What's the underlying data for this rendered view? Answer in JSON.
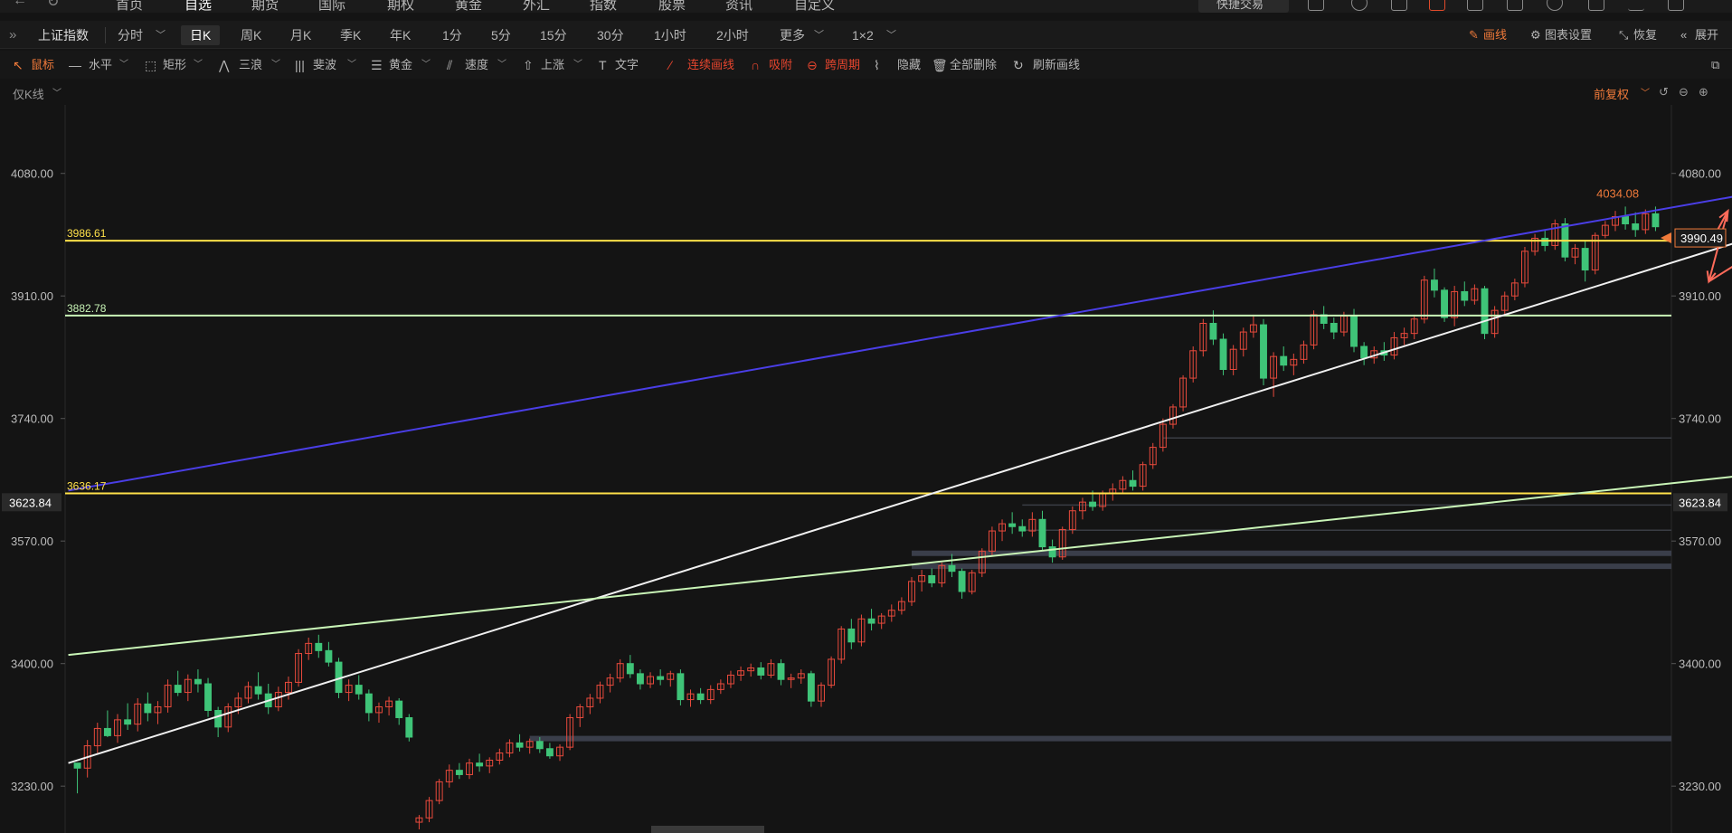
{
  "topnav": {
    "items": [
      "首页",
      "自选",
      "期货",
      "国际",
      "期权",
      "黄金",
      "外汇",
      "指数",
      "股票",
      "资讯",
      "自定义"
    ],
    "active_index": 1,
    "quick_trade": "快捷交易",
    "icons": [
      "back-icon",
      "refresh-icon",
      "layers-icon",
      "window-icon",
      "alert-icon",
      "chart-icon",
      "mail-icon",
      "user-icon",
      "minimize-icon",
      "close-icon"
    ]
  },
  "toolbar": {
    "symbol": "上证指数",
    "periods": [
      "分时",
      "日K",
      "周K",
      "月K",
      "季K",
      "年K",
      "1分",
      "5分",
      "15分",
      "30分",
      "1小时",
      "2小时",
      "更多",
      "1×2"
    ],
    "selected_period": "日K",
    "right": {
      "draw": "画线",
      "settings": "图表设置",
      "restore": "恢复",
      "expand": "展开"
    }
  },
  "drawbar": {
    "mouse": "鼠标",
    "hline": "水平",
    "rect": "矩形",
    "wave3": "三浪",
    "fib": "斐波",
    "gold": "黄金",
    "speed": "速度",
    "rise": "上涨",
    "text": "文字",
    "continuous": "连续画线",
    "snap": "吸附",
    "cross_period": "跨周期",
    "hide": "隐藏",
    "delete_all": "全部删除",
    "refresh_lines": "刷新画线"
  },
  "chart_header": {
    "kline_mode": "仅K线",
    "adjust": "前复权"
  },
  "colors": {
    "up": "#e84a3c",
    "down": "#3fc478",
    "yellow": "#ffe14a",
    "green_line": "#c9f5b7",
    "blue_line": "#4a3ee6",
    "white_line": "#f0f0f0",
    "arrow": "#ff6b5a",
    "bg": "#141414"
  },
  "chart_data": {
    "type": "candlestick",
    "axis_left_ticks": [
      "4080.00",
      "3910.00",
      "3740.00",
      "3570.00",
      "3400.00",
      "3230.00"
    ],
    "axis_right_ticks": [
      "4080.00",
      "3910.00",
      "3740.00",
      "3570.00",
      "3400.00",
      "3230.00"
    ],
    "ylim": [
      3165,
      4175
    ],
    "hlines": [
      {
        "label": "3986.61",
        "value": 3986.61,
        "color": "yellow"
      },
      {
        "label": "3882.78",
        "value": 3882.78,
        "color": "green"
      },
      {
        "label": "3636.17",
        "value": 3636.17,
        "color": "yellow"
      }
    ],
    "left_price_box": "3623.84",
    "right_price_box": "3623.84",
    "current_price": "3990.49",
    "high_label": "4034.08",
    "candles": [
      [
        3262,
        3262,
        3220,
        3255
      ],
      [
        3255,
        3294,
        3242,
        3286
      ],
      [
        3286,
        3318,
        3276,
        3310
      ],
      [
        3310,
        3335,
        3298,
        3300
      ],
      [
        3300,
        3330,
        3290,
        3322
      ],
      [
        3322,
        3345,
        3308,
        3316
      ],
      [
        3316,
        3352,
        3306,
        3344
      ],
      [
        3344,
        3360,
        3320,
        3332
      ],
      [
        3332,
        3348,
        3316,
        3340
      ],
      [
        3340,
        3378,
        3332,
        3370
      ],
      [
        3370,
        3390,
        3355,
        3360
      ],
      [
        3360,
        3385,
        3348,
        3378
      ],
      [
        3378,
        3392,
        3360,
        3372
      ],
      [
        3372,
        3380,
        3326,
        3335
      ],
      [
        3335,
        3340,
        3298,
        3312
      ],
      [
        3312,
        3345,
        3305,
        3340
      ],
      [
        3340,
        3360,
        3330,
        3352
      ],
      [
        3352,
        3375,
        3345,
        3368
      ],
      [
        3368,
        3388,
        3350,
        3358
      ],
      [
        3358,
        3372,
        3330,
        3340
      ],
      [
        3340,
        3368,
        3334,
        3360
      ],
      [
        3360,
        3382,
        3350,
        3374
      ],
      [
        3374,
        3420,
        3368,
        3414
      ],
      [
        3414,
        3436,
        3405,
        3428
      ],
      [
        3428,
        3440,
        3408,
        3418
      ],
      [
        3418,
        3430,
        3396,
        3402
      ],
      [
        3402,
        3408,
        3352,
        3360
      ],
      [
        3360,
        3378,
        3348,
        3370
      ],
      [
        3370,
        3384,
        3350,
        3358
      ],
      [
        3358,
        3364,
        3320,
        3332
      ],
      [
        3332,
        3346,
        3318,
        3340
      ],
      [
        3340,
        3354,
        3328,
        3348
      ],
      [
        3348,
        3352,
        3315,
        3325
      ],
      [
        3325,
        3330,
        3292,
        3298
      ],
      [
        3180,
        3190,
        3170,
        3186
      ],
      [
        3186,
        3215,
        3180,
        3210
      ],
      [
        3210,
        3240,
        3205,
        3236
      ],
      [
        3236,
        3260,
        3228,
        3252
      ],
      [
        3252,
        3262,
        3240,
        3246
      ],
      [
        3246,
        3268,
        3240,
        3262
      ],
      [
        3262,
        3275,
        3250,
        3258
      ],
      [
        3258,
        3270,
        3248,
        3266
      ],
      [
        3266,
        3282,
        3260,
        3276
      ],
      [
        3276,
        3295,
        3270,
        3290
      ],
      [
        3290,
        3302,
        3278,
        3284
      ],
      [
        3284,
        3296,
        3275,
        3292
      ],
      [
        3292,
        3298,
        3276,
        3282
      ],
      [
        3282,
        3290,
        3268,
        3272
      ],
      [
        3272,
        3288,
        3265,
        3284
      ],
      [
        3284,
        3330,
        3280,
        3325
      ],
      [
        3325,
        3344,
        3312,
        3340
      ],
      [
        3340,
        3358,
        3330,
        3352
      ],
      [
        3352,
        3375,
        3345,
        3370
      ],
      [
        3370,
        3386,
        3360,
        3380
      ],
      [
        3380,
        3406,
        3374,
        3400
      ],
      [
        3400,
        3412,
        3380,
        3386
      ],
      [
        3386,
        3392,
        3364,
        3372
      ],
      [
        3372,
        3388,
        3366,
        3382
      ],
      [
        3382,
        3392,
        3370,
        3378
      ],
      [
        3378,
        3390,
        3368,
        3386
      ],
      [
        3386,
        3392,
        3342,
        3350
      ],
      [
        3350,
        3364,
        3340,
        3358
      ],
      [
        3358,
        3366,
        3344,
        3350
      ],
      [
        3350,
        3370,
        3344,
        3364
      ],
      [
        3364,
        3378,
        3358,
        3372
      ],
      [
        3372,
        3390,
        3366,
        3384
      ],
      [
        3384,
        3396,
        3376,
        3390
      ],
      [
        3390,
        3400,
        3382,
        3394
      ],
      [
        3394,
        3402,
        3378,
        3384
      ],
      [
        3384,
        3406,
        3380,
        3400
      ],
      [
        3400,
        3406,
        3370,
        3378
      ],
      [
        3378,
        3386,
        3366,
        3380
      ],
      [
        3380,
        3392,
        3372,
        3386
      ],
      [
        3386,
        3390,
        3340,
        3348
      ],
      [
        3348,
        3374,
        3340,
        3370
      ],
      [
        3370,
        3410,
        3366,
        3406
      ],
      [
        3406,
        3452,
        3400,
        3448
      ],
      [
        3448,
        3462,
        3420,
        3430
      ],
      [
        3430,
        3468,
        3424,
        3462
      ],
      [
        3462,
        3476,
        3446,
        3456
      ],
      [
        3456,
        3470,
        3448,
        3466
      ],
      [
        3466,
        3482,
        3458,
        3474
      ],
      [
        3474,
        3492,
        3468,
        3486
      ],
      [
        3486,
        3520,
        3480,
        3514
      ],
      [
        3514,
        3530,
        3500,
        3522
      ],
      [
        3522,
        3532,
        3506,
        3512
      ],
      [
        3512,
        3540,
        3506,
        3536
      ],
      [
        3536,
        3552,
        3520,
        3528
      ],
      [
        3528,
        3532,
        3490,
        3500
      ],
      [
        3500,
        3530,
        3496,
        3526
      ],
      [
        3526,
        3560,
        3520,
        3556
      ],
      [
        3556,
        3590,
        3550,
        3584
      ],
      [
        3584,
        3600,
        3570,
        3594
      ],
      [
        3594,
        3610,
        3580,
        3590
      ],
      [
        3590,
        3600,
        3576,
        3584
      ],
      [
        3584,
        3610,
        3576,
        3600
      ],
      [
        3600,
        3612,
        3556,
        3562
      ],
      [
        3562,
        3572,
        3540,
        3548
      ],
      [
        3548,
        3590,
        3544,
        3586
      ],
      [
        3586,
        3618,
        3580,
        3612
      ],
      [
        3612,
        3630,
        3600,
        3624
      ],
      [
        3624,
        3640,
        3612,
        3618
      ],
      [
        3618,
        3640,
        3612,
        3636
      ],
      [
        3636,
        3650,
        3626,
        3642
      ],
      [
        3642,
        3660,
        3636,
        3654
      ],
      [
        3654,
        3668,
        3640,
        3646
      ],
      [
        3646,
        3680,
        3640,
        3676
      ],
      [
        3676,
        3706,
        3670,
        3700
      ],
      [
        3700,
        3740,
        3694,
        3732
      ],
      [
        3732,
        3760,
        3726,
        3756
      ],
      [
        3756,
        3800,
        3750,
        3796
      ],
      [
        3796,
        3840,
        3790,
        3834
      ],
      [
        3834,
        3878,
        3826,
        3872
      ],
      [
        3872,
        3890,
        3842,
        3850
      ],
      [
        3850,
        3858,
        3800,
        3808
      ],
      [
        3808,
        3842,
        3800,
        3836
      ],
      [
        3836,
        3866,
        3826,
        3860
      ],
      [
        3860,
        3884,
        3852,
        3870
      ],
      [
        3870,
        3878,
        3786,
        3796
      ],
      [
        3796,
        3832,
        3770,
        3826
      ],
      [
        3826,
        3840,
        3806,
        3814
      ],
      [
        3814,
        3830,
        3800,
        3822
      ],
      [
        3822,
        3848,
        3816,
        3842
      ],
      [
        3842,
        3890,
        3836,
        3884
      ],
      [
        3884,
        3896,
        3864,
        3872
      ],
      [
        3872,
        3880,
        3850,
        3860
      ],
      [
        3860,
        3888,
        3854,
        3882
      ],
      [
        3882,
        3892,
        3832,
        3840
      ],
      [
        3840,
        3846,
        3814,
        3824
      ],
      [
        3824,
        3840,
        3816,
        3834
      ],
      [
        3834,
        3846,
        3820,
        3828
      ],
      [
        3828,
        3860,
        3822,
        3852
      ],
      [
        3852,
        3866,
        3842,
        3858
      ],
      [
        3858,
        3884,
        3850,
        3878
      ],
      [
        3878,
        3938,
        3872,
        3932
      ],
      [
        3932,
        3948,
        3908,
        3918
      ],
      [
        3918,
        3922,
        3874,
        3880
      ],
      [
        3880,
        3924,
        3868,
        3916
      ],
      [
        3916,
        3930,
        3896,
        3904
      ],
      [
        3904,
        3926,
        3898,
        3920
      ],
      [
        3920,
        3924,
        3850,
        3858
      ],
      [
        3858,
        3896,
        3852,
        3890
      ],
      [
        3890,
        3916,
        3884,
        3910
      ],
      [
        3910,
        3934,
        3904,
        3928
      ],
      [
        3928,
        3978,
        3922,
        3972
      ],
      [
        3972,
        3996,
        3966,
        3990
      ],
      [
        3990,
        4002,
        3972,
        3980
      ],
      [
        3980,
        4016,
        3974,
        4010
      ],
      [
        4010,
        4018,
        3958,
        3964
      ],
      [
        3964,
        3982,
        3954,
        3976
      ],
      [
        3976,
        3986,
        3930,
        3946
      ],
      [
        3946,
        3998,
        3940,
        3994
      ],
      [
        3994,
        4014,
        3990,
        4008
      ],
      [
        4008,
        4028,
        4000,
        4020
      ],
      [
        4020,
        4034,
        4002,
        4010
      ],
      [
        4010,
        4026,
        3992,
        4002
      ],
      [
        4002,
        4030,
        3996,
        4024
      ],
      [
        4024,
        4034,
        4000,
        4006
      ]
    ],
    "annotations": {
      "lines": [
        {
          "name": "blue-trendline",
          "p1": [
            0,
            3640
          ],
          "p2": [
            170,
            4062
          ],
          "color": "blue"
        },
        {
          "name": "white-trendline",
          "p1": [
            0,
            3262
          ],
          "p2": [
            170,
            4008
          ],
          "color": "white"
        },
        {
          "name": "green-trendline",
          "p1": [
            0,
            3412
          ],
          "p2": [
            170,
            3668
          ],
          "color": "green"
        }
      ],
      "shaded_bands": [
        {
          "value": 3296,
          "from_x": 45
        },
        {
          "value": 3553,
          "from_x": 83
        },
        {
          "value": 3535,
          "from_x": 83
        }
      ],
      "faint_lines": [
        {
          "value": 3713,
          "from_x": 108
        },
        {
          "value": 3620,
          "from_x": 94
        },
        {
          "value": 3585,
          "from_x": 94
        }
      ],
      "arrow_path": [
        [
          162.8,
          3992
        ],
        [
          164.2,
          4028
        ],
        [
          162.3,
          3930
        ],
        [
          168,
          3980
        ],
        [
          168,
          3660
        ]
      ]
    }
  }
}
